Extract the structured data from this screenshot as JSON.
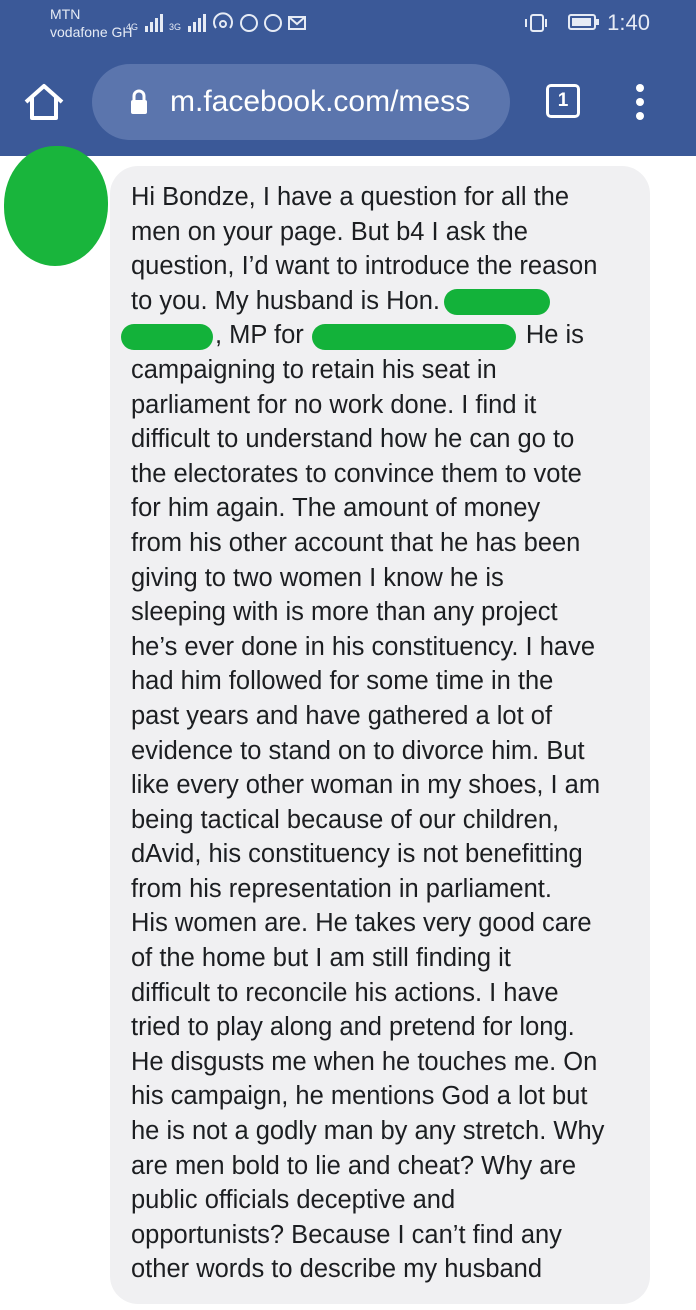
{
  "status_bar": {
    "carrier_primary": "MTN",
    "carrier_secondary": "vodafone GH",
    "net1": "4G",
    "net2": "3G",
    "battery_level": 0.95,
    "time": "1:40"
  },
  "browser": {
    "url": "m.facebook.com/mess",
    "tab_count": "1",
    "toolbar_color": "#3b5998"
  },
  "message": {
    "lines": [
      "Hi Bondze, I have a question for all the",
      "men on your page. But b4 I ask the",
      "question, I’d want to introduce the reason",
      "to you. My husband is Hon.",
      ", MP for",
      "campaigning to retain his seat in",
      "parliament for no work done. I find it",
      "difficult to understand how he can go to",
      "the electorates to convince them to vote",
      "for him again. The amount of money",
      "from his other account that he has been",
      "giving to two women I know he is",
      "sleeping with is more than any project",
      "he’s ever done in his constituency. I have",
      "had him followed for some time in the",
      "past years and have gathered a lot of",
      "evidence to stand on to divorce him. But",
      "like every other woman in my shoes, I am",
      "being tactical because of our children,",
      "dAvid, his constituency is not benefitting",
      "from his representation in parliament.",
      "His women are. He takes very good care",
      "of the home but I am still finding it",
      "difficult to reconcile his actions. I have",
      "tried to play along and pretend for long.",
      "He disgusts me when he touches me. On",
      "his campaign, he mentions God a lot but",
      "he is not a godly man by any stretch. Why",
      "are men bold to lie and cheat? Why are",
      "public officials deceptive and",
      "opportunists? Because I can’t find any",
      "other words to describe my husband"
    ],
    "line5_tail": "He is"
  }
}
